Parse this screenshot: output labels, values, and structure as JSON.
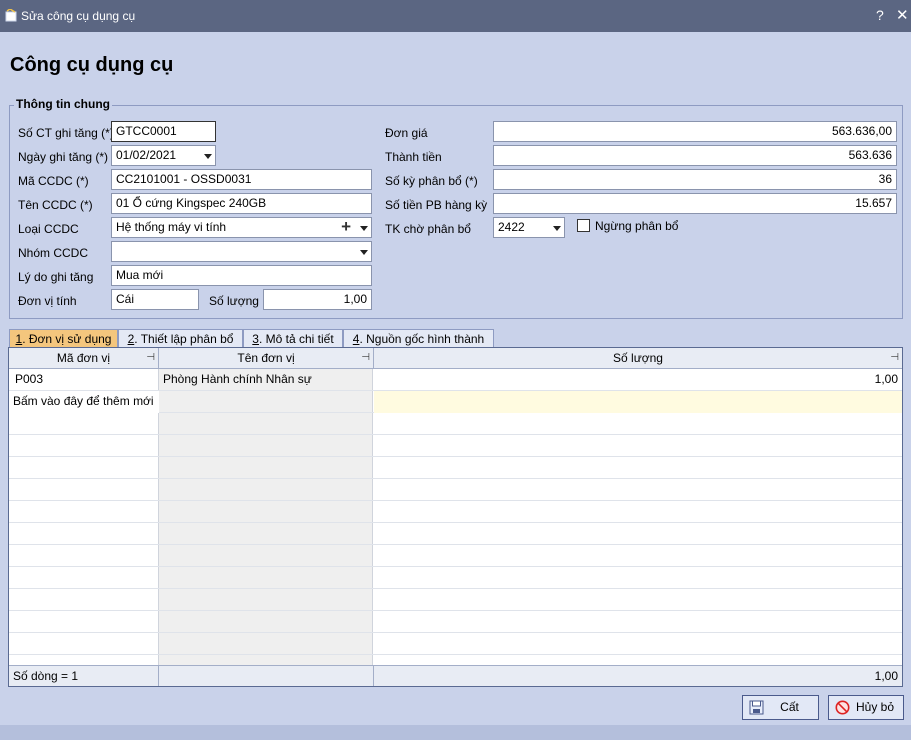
{
  "window": {
    "title": "Sửa công cụ dụng cụ",
    "help": "?",
    "close": "✕"
  },
  "header": {
    "title": "Công cụ dụng cụ"
  },
  "group": {
    "legend": "Thông tin chung"
  },
  "form": {
    "so_ct_label": "Số CT ghi tăng (*)",
    "so_ct_value": "GTCC0001",
    "ngay_label": "Ngày ghi tăng (*)",
    "ngay_value": "01/02/2021",
    "ma_label": "Mã CCDC (*)",
    "ma_value": "CC2101001 - OSSD0031",
    "ten_label": "Tên CCDC (*)",
    "ten_value": "01 Ổ cứng Kingspec 240GB",
    "loai_label": "Loại CCDC",
    "loai_value": "Hệ thống máy vi tính",
    "plus": "+",
    "nhom_label": "Nhóm CCDC",
    "nhom_value": "",
    "lydo_label": "Lý do ghi tăng",
    "lydo_value": "Mua mới",
    "dvt_label": "Đơn vị tính",
    "dvt_value": "Cái",
    "soluong_label": "Số lượng",
    "soluong_value": "1,00",
    "dongia_label": "Đơn giá",
    "dongia_value": "563.636,00",
    "thanhtien_label": "Thành tiền",
    "thanhtien_value": "563.636",
    "soky_label": "Số kỳ phân bổ (*)",
    "soky_value": "36",
    "sotien_label": "Số tiền PB hàng kỳ",
    "sotien_value": "15.657",
    "tk_label": "TK chờ phân bổ",
    "tk_value": "2422",
    "ngung_label": "Ngừng phân bổ",
    "ngung_checked": false
  },
  "tabs": [
    {
      "num": "1",
      "label": ". Đơn vị sử dụng"
    },
    {
      "num": "2",
      "label": ". Thiết lập phân bổ"
    },
    {
      "num": "3",
      "label": ". Mô tả chi tiết"
    },
    {
      "num": "4",
      "label": ". Nguồn gốc hình thành"
    }
  ],
  "grid": {
    "columns": [
      "Mã đơn vị",
      "Tên đơn vị",
      "Số lượng"
    ],
    "pin": "⊣",
    "rows": [
      {
        "ma": "P003",
        "ten": "Phòng Hành chính Nhân sự",
        "soluong": "1,00"
      }
    ],
    "new_row_hint": "Bấm vào đây để thêm mới",
    "footer_count": "Số dòng = 1",
    "footer_total": "1,00"
  },
  "buttons": {
    "save": "Cất",
    "cancel": "Hủy bỏ"
  },
  "colors": {
    "titlebar": "#5b6682",
    "background": "#c9d2ea",
    "active_tab": "#f4c67d",
    "new_row": "#fffbe0"
  }
}
